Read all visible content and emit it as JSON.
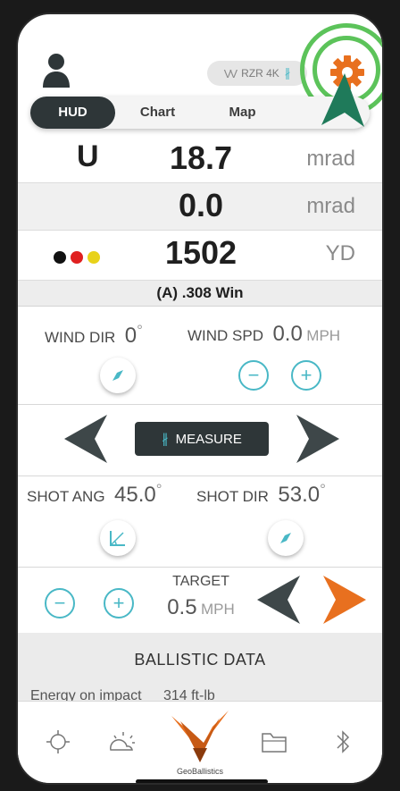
{
  "device": {
    "name": "RZR 4K"
  },
  "tabs": [
    {
      "label": "HUD",
      "active": true
    },
    {
      "label": "Chart",
      "active": false
    },
    {
      "label": "Map",
      "active": false
    }
  ],
  "hud": {
    "elevation": {
      "direction": "U",
      "value": "18.7",
      "unit": "mrad"
    },
    "windage": {
      "value": "0.0",
      "unit": "mrad"
    },
    "range": {
      "value": "1502",
      "unit": "YD",
      "dot_colors": [
        "#111111",
        "#e02020",
        "#e8d21a"
      ]
    }
  },
  "ammo": {
    "label": "(A) .308 Win"
  },
  "wind": {
    "dir_label": "WIND DIR",
    "dir_value": "0",
    "dir_unit": "°",
    "spd_label": "WIND SPD",
    "spd_value": "0.0",
    "spd_unit": "MPH"
  },
  "measure": {
    "label": "MEASURE"
  },
  "shot": {
    "ang_label": "SHOT ANG",
    "ang_value": "45.0",
    "ang_unit": "°",
    "dir_label": "SHOT DIR",
    "dir_value": "53.0",
    "dir_unit": "°"
  },
  "target": {
    "label": "TARGET",
    "value": "0.5",
    "unit": "MPH"
  },
  "ballistic": {
    "title": "BALLISTIC DATA",
    "energy_label": "Energy on impact",
    "energy_value": "314 ft-lb"
  },
  "bottom_nav": {
    "items": [
      "crosshair-icon",
      "weather-icon",
      "geoballistics-logo",
      "folder-icon",
      "bluetooth-icon"
    ],
    "logo_text": "GeoBallistics"
  },
  "colors": {
    "accent": "#49b8c6",
    "orange": "#e8701f",
    "dark": "#2e3638",
    "highlight": "#5cc35a",
    "cursor": "#1f7a5a"
  }
}
